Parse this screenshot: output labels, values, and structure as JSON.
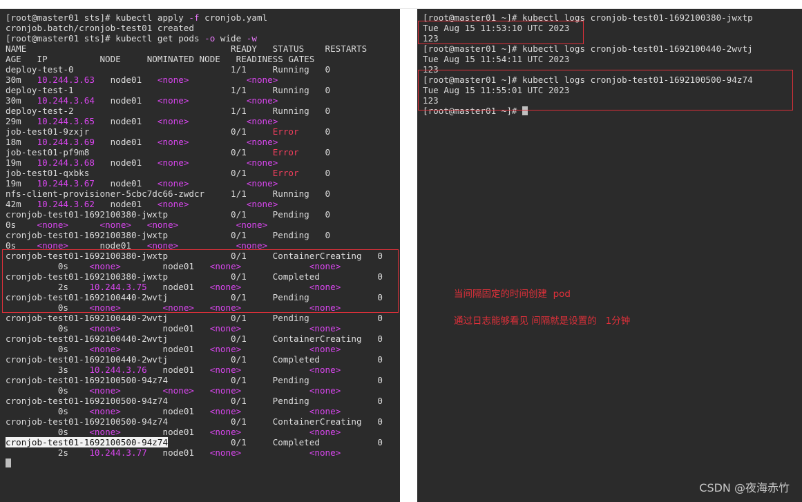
{
  "colors": {
    "terminal_bg": "#2b2b2b",
    "text": "#dcdcdc",
    "magenta": "#d946ef",
    "error_red": "#f43f5e",
    "annotation_red": "#e0303a"
  },
  "left_terminal": {
    "lines": [
      [
        {
          "t": "[root@master01 sts]# kubectl apply "
        },
        {
          "t": "-f",
          "c": "flag"
        },
        {
          "t": " cronjob.yaml"
        }
      ],
      [
        {
          "t": "cronjob.batch/cronjob-test01 created"
        }
      ],
      [
        {
          "t": "[root@master01 sts]# kubectl get pods "
        },
        {
          "t": "-o",
          "c": "flag"
        },
        {
          "t": " wide "
        },
        {
          "t": "-w",
          "c": "flag"
        }
      ],
      [
        {
          "t": "NAME                                       READY   STATUS    RESTARTS"
        }
      ],
      [
        {
          "t": "AGE   IP          NODE     NOMINATED NODE   READINESS GATES"
        }
      ],
      [
        {
          "t": "deploy-test-0                              1/1     Running   0"
        }
      ],
      [
        {
          "t": "30m   "
        },
        {
          "t": "10.244.3.63",
          "c": "mag"
        },
        {
          "t": "   node01   "
        },
        {
          "t": "<none>",
          "c": "mag"
        },
        {
          "t": "           "
        },
        {
          "t": "<none>",
          "c": "mag"
        }
      ],
      [
        {
          "t": "deploy-test-1                              1/1     Running   0"
        }
      ],
      [
        {
          "t": "30m   "
        },
        {
          "t": "10.244.3.64",
          "c": "mag"
        },
        {
          "t": "   node01   "
        },
        {
          "t": "<none>",
          "c": "mag"
        },
        {
          "t": "           "
        },
        {
          "t": "<none>",
          "c": "mag"
        }
      ],
      [
        {
          "t": "deploy-test-2                              1/1     Running   0"
        }
      ],
      [
        {
          "t": "29m   "
        },
        {
          "t": "10.244.3.65",
          "c": "mag"
        },
        {
          "t": "   node01   "
        },
        {
          "t": "<none>",
          "c": "mag"
        },
        {
          "t": "           "
        },
        {
          "t": "<none>",
          "c": "mag"
        }
      ],
      [
        {
          "t": "job-test01-9zxjr                           0/1     "
        },
        {
          "t": "Error",
          "c": "red"
        },
        {
          "t": "     0"
        }
      ],
      [
        {
          "t": "18m   "
        },
        {
          "t": "10.244.3.69",
          "c": "mag"
        },
        {
          "t": "   node01   "
        },
        {
          "t": "<none>",
          "c": "mag"
        },
        {
          "t": "           "
        },
        {
          "t": "<none>",
          "c": "mag"
        }
      ],
      [
        {
          "t": "job-test01-pf9m8                           0/1     "
        },
        {
          "t": "Error",
          "c": "red"
        },
        {
          "t": "     0"
        }
      ],
      [
        {
          "t": "19m   "
        },
        {
          "t": "10.244.3.68",
          "c": "mag"
        },
        {
          "t": "   node01   "
        },
        {
          "t": "<none>",
          "c": "mag"
        },
        {
          "t": "           "
        },
        {
          "t": "<none>",
          "c": "mag"
        }
      ],
      [
        {
          "t": "job-test01-qxbks                           0/1     "
        },
        {
          "t": "Error",
          "c": "red"
        },
        {
          "t": "     0"
        }
      ],
      [
        {
          "t": "19m   "
        },
        {
          "t": "10.244.3.67",
          "c": "mag"
        },
        {
          "t": "   node01   "
        },
        {
          "t": "<none>",
          "c": "mag"
        },
        {
          "t": "           "
        },
        {
          "t": "<none>",
          "c": "mag"
        }
      ],
      [
        {
          "t": "nfs-client-provisioner-5cbc7dc66-zwdcr     1/1     Running   0"
        }
      ],
      [
        {
          "t": "42m   "
        },
        {
          "t": "10.244.3.62",
          "c": "mag"
        },
        {
          "t": "   node01   "
        },
        {
          "t": "<none>",
          "c": "mag"
        },
        {
          "t": "           "
        },
        {
          "t": "<none>",
          "c": "mag"
        }
      ],
      [
        {
          "t": "cronjob-test01-1692100380-jwxtp            0/1     Pending   0"
        }
      ],
      [
        {
          "t": "0s    "
        },
        {
          "t": "<none>",
          "c": "mag"
        },
        {
          "t": "      "
        },
        {
          "t": "<none>",
          "c": "mag"
        },
        {
          "t": "   "
        },
        {
          "t": "<none>",
          "c": "mag"
        },
        {
          "t": "           "
        },
        {
          "t": "<none>",
          "c": "mag"
        }
      ],
      [
        {
          "t": "cronjob-test01-1692100380-jwxtp            0/1     Pending   0"
        }
      ],
      [
        {
          "t": "0s    "
        },
        {
          "t": "<none>",
          "c": "mag"
        },
        {
          "t": "      node01   "
        },
        {
          "t": "<none>",
          "c": "mag"
        },
        {
          "t": "           "
        },
        {
          "t": "<none>",
          "c": "mag"
        }
      ],
      [
        {
          "t": "cronjob-test01-1692100380-jwxtp            0/1     ContainerCreating   0"
        }
      ],
      [
        {
          "t": "          0s    "
        },
        {
          "t": "<none>",
          "c": "mag"
        },
        {
          "t": "        node01   "
        },
        {
          "t": "<none>",
          "c": "mag"
        },
        {
          "t": "             "
        },
        {
          "t": "<none>",
          "c": "mag"
        }
      ],
      [
        {
          "t": "cronjob-test01-1692100380-jwxtp            0/1     Completed           0"
        }
      ],
      [
        {
          "t": "          2s    "
        },
        {
          "t": "10.244.3.75",
          "c": "mag"
        },
        {
          "t": "   node01   "
        },
        {
          "t": "<none>",
          "c": "mag"
        },
        {
          "t": "             "
        },
        {
          "t": "<none>",
          "c": "mag"
        }
      ],
      [
        {
          "t": "cronjob-test01-1692100440-2wvtj            0/1     Pending             0"
        }
      ],
      [
        {
          "t": "          0s    "
        },
        {
          "t": "<none>",
          "c": "mag"
        },
        {
          "t": "        "
        },
        {
          "t": "<none>",
          "c": "mag"
        },
        {
          "t": "   "
        },
        {
          "t": "<none>",
          "c": "mag"
        },
        {
          "t": "             "
        },
        {
          "t": "<none>",
          "c": "mag"
        }
      ],
      [
        {
          "t": "cronjob-test01-1692100440-2wvtj            0/1     Pending             0"
        }
      ],
      [
        {
          "t": "          0s    "
        },
        {
          "t": "<none>",
          "c": "mag"
        },
        {
          "t": "        node01   "
        },
        {
          "t": "<none>",
          "c": "mag"
        },
        {
          "t": "             "
        },
        {
          "t": "<none>",
          "c": "mag"
        }
      ],
      [
        {
          "t": "cronjob-test01-1692100440-2wvtj            0/1     ContainerCreating   0"
        }
      ],
      [
        {
          "t": "          0s    "
        },
        {
          "t": "<none>",
          "c": "mag"
        },
        {
          "t": "        node01   "
        },
        {
          "t": "<none>",
          "c": "mag"
        },
        {
          "t": "             "
        },
        {
          "t": "<none>",
          "c": "mag"
        }
      ],
      [
        {
          "t": "cronjob-test01-1692100440-2wvtj            0/1     Completed           0"
        }
      ],
      [
        {
          "t": "          3s    "
        },
        {
          "t": "10.244.3.76",
          "c": "mag"
        },
        {
          "t": "   node01   "
        },
        {
          "t": "<none>",
          "c": "mag"
        },
        {
          "t": "             "
        },
        {
          "t": "<none>",
          "c": "mag"
        }
      ],
      [
        {
          "t": "cronjob-test01-1692100500-94z74            0/1     Pending             0"
        }
      ],
      [
        {
          "t": "          0s    "
        },
        {
          "t": "<none>",
          "c": "mag"
        },
        {
          "t": "        "
        },
        {
          "t": "<none>",
          "c": "mag"
        },
        {
          "t": "   "
        },
        {
          "t": "<none>",
          "c": "mag"
        },
        {
          "t": "             "
        },
        {
          "t": "<none>",
          "c": "mag"
        }
      ],
      [
        {
          "t": "cronjob-test01-1692100500-94z74            0/1     Pending             0"
        }
      ],
      [
        {
          "t": "          0s    "
        },
        {
          "t": "<none>",
          "c": "mag"
        },
        {
          "t": "        node01   "
        },
        {
          "t": "<none>",
          "c": "mag"
        },
        {
          "t": "             "
        },
        {
          "t": "<none>",
          "c": "mag"
        }
      ],
      [
        {
          "t": "cronjob-test01-1692100500-94z74            0/1     ContainerCreating   0"
        }
      ],
      [
        {
          "t": "          0s    "
        },
        {
          "t": "<none>",
          "c": "mag"
        },
        {
          "t": "        node01   "
        },
        {
          "t": "<none>",
          "c": "mag"
        },
        {
          "t": "             "
        },
        {
          "t": "<none>",
          "c": "mag"
        }
      ],
      [
        {
          "t": "cronjob-test01-1692100500-94z74",
          "c": "sel"
        },
        {
          "t": "            0/1     Completed           0"
        }
      ],
      [
        {
          "t": "          2s    "
        },
        {
          "t": "10.244.3.77",
          "c": "mag"
        },
        {
          "t": "   node01   "
        },
        {
          "t": "<none>",
          "c": "mag"
        },
        {
          "t": "             "
        },
        {
          "t": "<none>",
          "c": "mag"
        }
      ]
    ]
  },
  "right_terminal": {
    "lines": [
      [
        {
          "t": "[root@master01 ~]# kubectl logs cronjob-test01-1692100380-jwxtp"
        }
      ],
      [
        {
          "t": "Tue Aug 15 11:53:10 UTC 2023"
        }
      ],
      [
        {
          "t": "123"
        }
      ],
      [
        {
          "t": "[root@master01 ~]# kubectl logs cronjob-test01-1692100440-2wvtj"
        }
      ],
      [
        {
          "t": "Tue Aug 15 11:54:11 UTC 2023"
        }
      ],
      [
        {
          "t": "123"
        }
      ],
      [
        {
          "t": "[root@master01 ~]# kubectl logs cronjob-test01-1692100500-94z74"
        }
      ],
      [
        {
          "t": "Tue Aug 15 11:55:01 UTC 2023"
        }
      ],
      [
        {
          "t": "123"
        }
      ],
      [
        {
          "t": "[root@master01 ~]# "
        }
      ]
    ]
  },
  "annotations": {
    "line1": "当间隔固定的时间创建  pod",
    "line2": "通过日志能够看见 间隔就是设置的   1分钟"
  },
  "watermark": "CSDN @夜海赤竹"
}
